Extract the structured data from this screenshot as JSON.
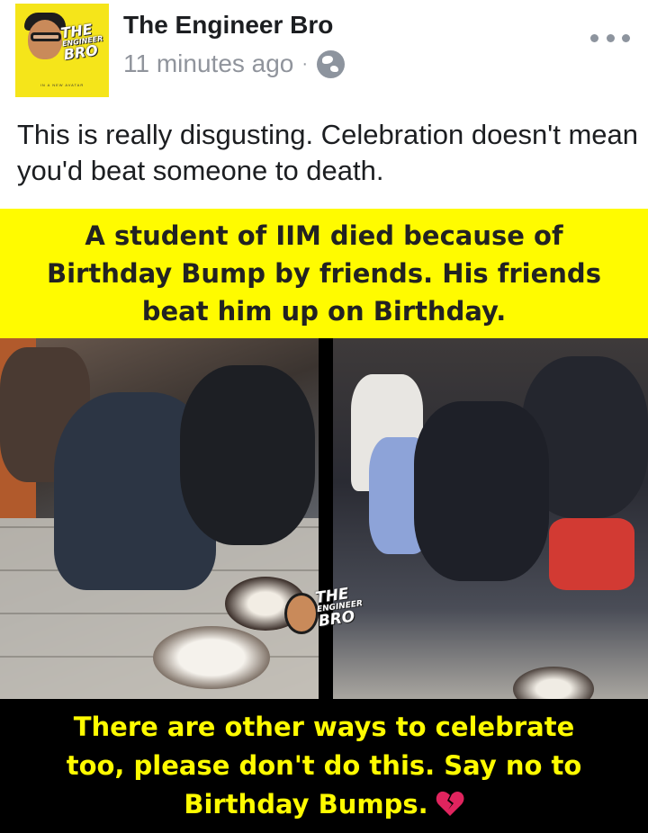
{
  "post": {
    "page_name": "The Engineer Bro",
    "timestamp": "11 minutes ago",
    "separator": "·",
    "privacy_icon": "globe-icon",
    "more_icon": "more-options-icon",
    "text": "This is really disgusting. Celebration doesn't mean you'd beat someone to death."
  },
  "avatar": {
    "logo_line1": "THE",
    "logo_line2": "ENGINEER",
    "logo_line3": "BRO",
    "tagline": "IN A NEW AVATAR"
  },
  "image": {
    "top_caption": "A student of IIM died because of\nBirthday Bump by friends. His friends\nbeat him up on Birthday.",
    "bottom_caption": "There are other ways to celebrate\ntoo, please don't do this. Say no to\nBirthday Bumps.",
    "bottom_icon": "broken-heart-icon",
    "watermark_line1": "THE",
    "watermark_line2": "ENGINEER",
    "watermark_line3": "BRO"
  },
  "colors": {
    "banner_yellow": "#fffb00",
    "avatar_yellow": "#f5e51a",
    "meta_gray": "#90949c",
    "text_dark": "#1c1e21",
    "heart_red": "#e0245e"
  }
}
